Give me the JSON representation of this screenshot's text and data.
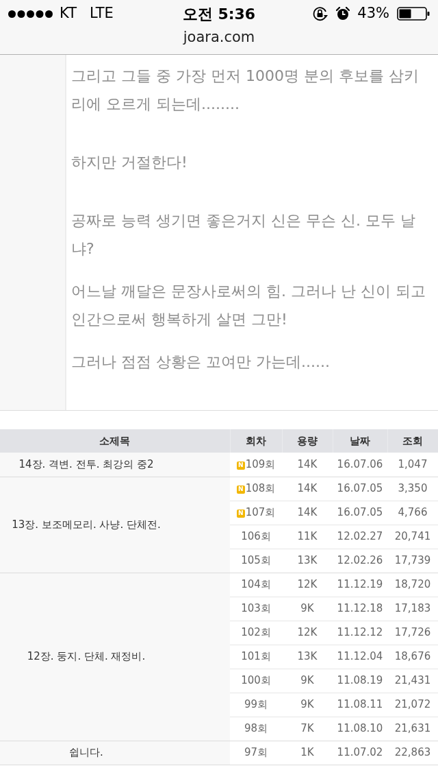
{
  "status_bar": {
    "carrier": "KT",
    "network": "LTE",
    "time": "오전 5:36",
    "battery_text": "43%"
  },
  "address_bar": {
    "url": "joara.com"
  },
  "story": {
    "paragraphs": [
      {
        "lines": [
          "그리고 그들 중 가장 먼저 1000명 분의 후보를 삼키",
          "리에 오르게 되는데........"
        ]
      },
      {
        "lines": [
          "하지만 거절한다!"
        ]
      },
      {
        "lines": [
          "공짜로 능력 생기면 좋은거지 신은 무슨 신. 모두 날",
          "냐?"
        ]
      },
      {
        "lines": [
          "어느날 깨달은 문장사로써의 힘. 그러나 난 신이 되고",
          "인간으로써 행복하게 살면 그만!"
        ]
      },
      {
        "lines": [
          "그러나 점점 상황은 꼬여만 가는데......"
        ]
      }
    ]
  },
  "episode_table": {
    "columns": [
      "소제목",
      "회차",
      "용량",
      "날짜",
      "조회"
    ],
    "groups": [
      {
        "title": "14장. 격변. 전투. 최강의 중2",
        "episodes": [
          {
            "episode": "109회",
            "badge": "N",
            "size": "14K",
            "date": "16.07.06",
            "views": "1,047"
          }
        ]
      },
      {
        "title": "13장. 보조메모리. 사냥. 단체전.",
        "episodes": [
          {
            "episode": "108회",
            "badge": "N",
            "size": "14K",
            "date": "16.07.05",
            "views": "3,350"
          },
          {
            "episode": "107회",
            "badge": "N",
            "size": "14K",
            "date": "16.07.05",
            "views": "4,766"
          },
          {
            "episode": "106회",
            "size": "11K",
            "date": "12.02.27",
            "views": "20,741"
          },
          {
            "episode": "105회",
            "size": "13K",
            "date": "12.02.26",
            "views": "17,739"
          }
        ]
      },
      {
        "title": "12장. 둥지. 단체. 재정비.",
        "episodes": [
          {
            "episode": "104회",
            "size": "12K",
            "date": "11.12.19",
            "views": "18,720"
          },
          {
            "episode": "103회",
            "size": "9K",
            "date": "11.12.18",
            "views": "17,183"
          },
          {
            "episode": "102회",
            "size": "12K",
            "date": "11.12.12",
            "views": "17,726"
          },
          {
            "episode": "101회",
            "size": "13K",
            "date": "11.12.04",
            "views": "18,676"
          },
          {
            "episode": "100회",
            "size": "9K",
            "date": "11.08.19",
            "views": "21,431"
          },
          {
            "episode": "99회",
            "size": "9K",
            "date": "11.08.11",
            "views": "21,072"
          },
          {
            "episode": "98회",
            "size": "7K",
            "date": "11.08.10",
            "views": "21,631"
          }
        ]
      },
      {
        "title": "쉽니다.",
        "episodes": [
          {
            "episode": "97회",
            "size": "1K",
            "date": "11.07.02",
            "views": "22,863"
          }
        ]
      }
    ]
  }
}
